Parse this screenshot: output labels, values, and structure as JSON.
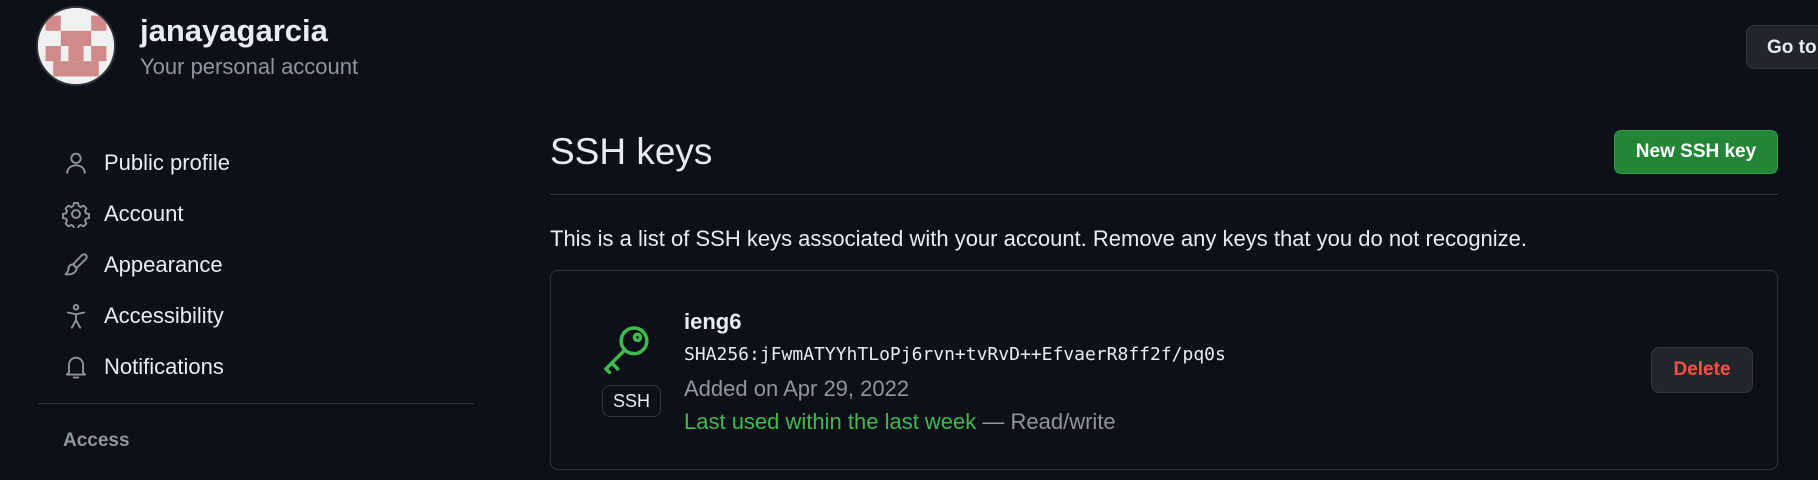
{
  "header": {
    "username": "janayagarcia",
    "subtitle": "Your personal account",
    "goto_label": "Go to"
  },
  "sidebar": {
    "items": [
      {
        "label": "Public profile",
        "icon": "person-icon"
      },
      {
        "label": "Account",
        "icon": "gear-icon"
      },
      {
        "label": "Appearance",
        "icon": "paintbrush-icon"
      },
      {
        "label": "Accessibility",
        "icon": "accessibility-icon"
      },
      {
        "label": "Notifications",
        "icon": "bell-icon"
      }
    ],
    "section_heading": "Access"
  },
  "main": {
    "title": "SSH keys",
    "new_key_label": "New SSH key",
    "description": "This is a list of SSH keys associated with your account. Remove any keys that you do not recognize.",
    "key": {
      "name": "ieng6",
      "fingerprint": "SHA256:jFwmATYYhTLoPj6rvn+tvRvD++EfvaerR8ff2f/pq0s",
      "added": "Added on Apr 29, 2022",
      "last_used": "Last used within the last week",
      "access": " — Read/write",
      "badge": "SSH",
      "icon": "key-icon",
      "delete_label": "Delete"
    }
  },
  "colors": {
    "background": "#0d1117",
    "border": "#30363d",
    "text": "#e6edf3",
    "muted": "#8d96a0",
    "success": "#3fb950",
    "primary_button": "#238636",
    "danger": "#f85149"
  }
}
